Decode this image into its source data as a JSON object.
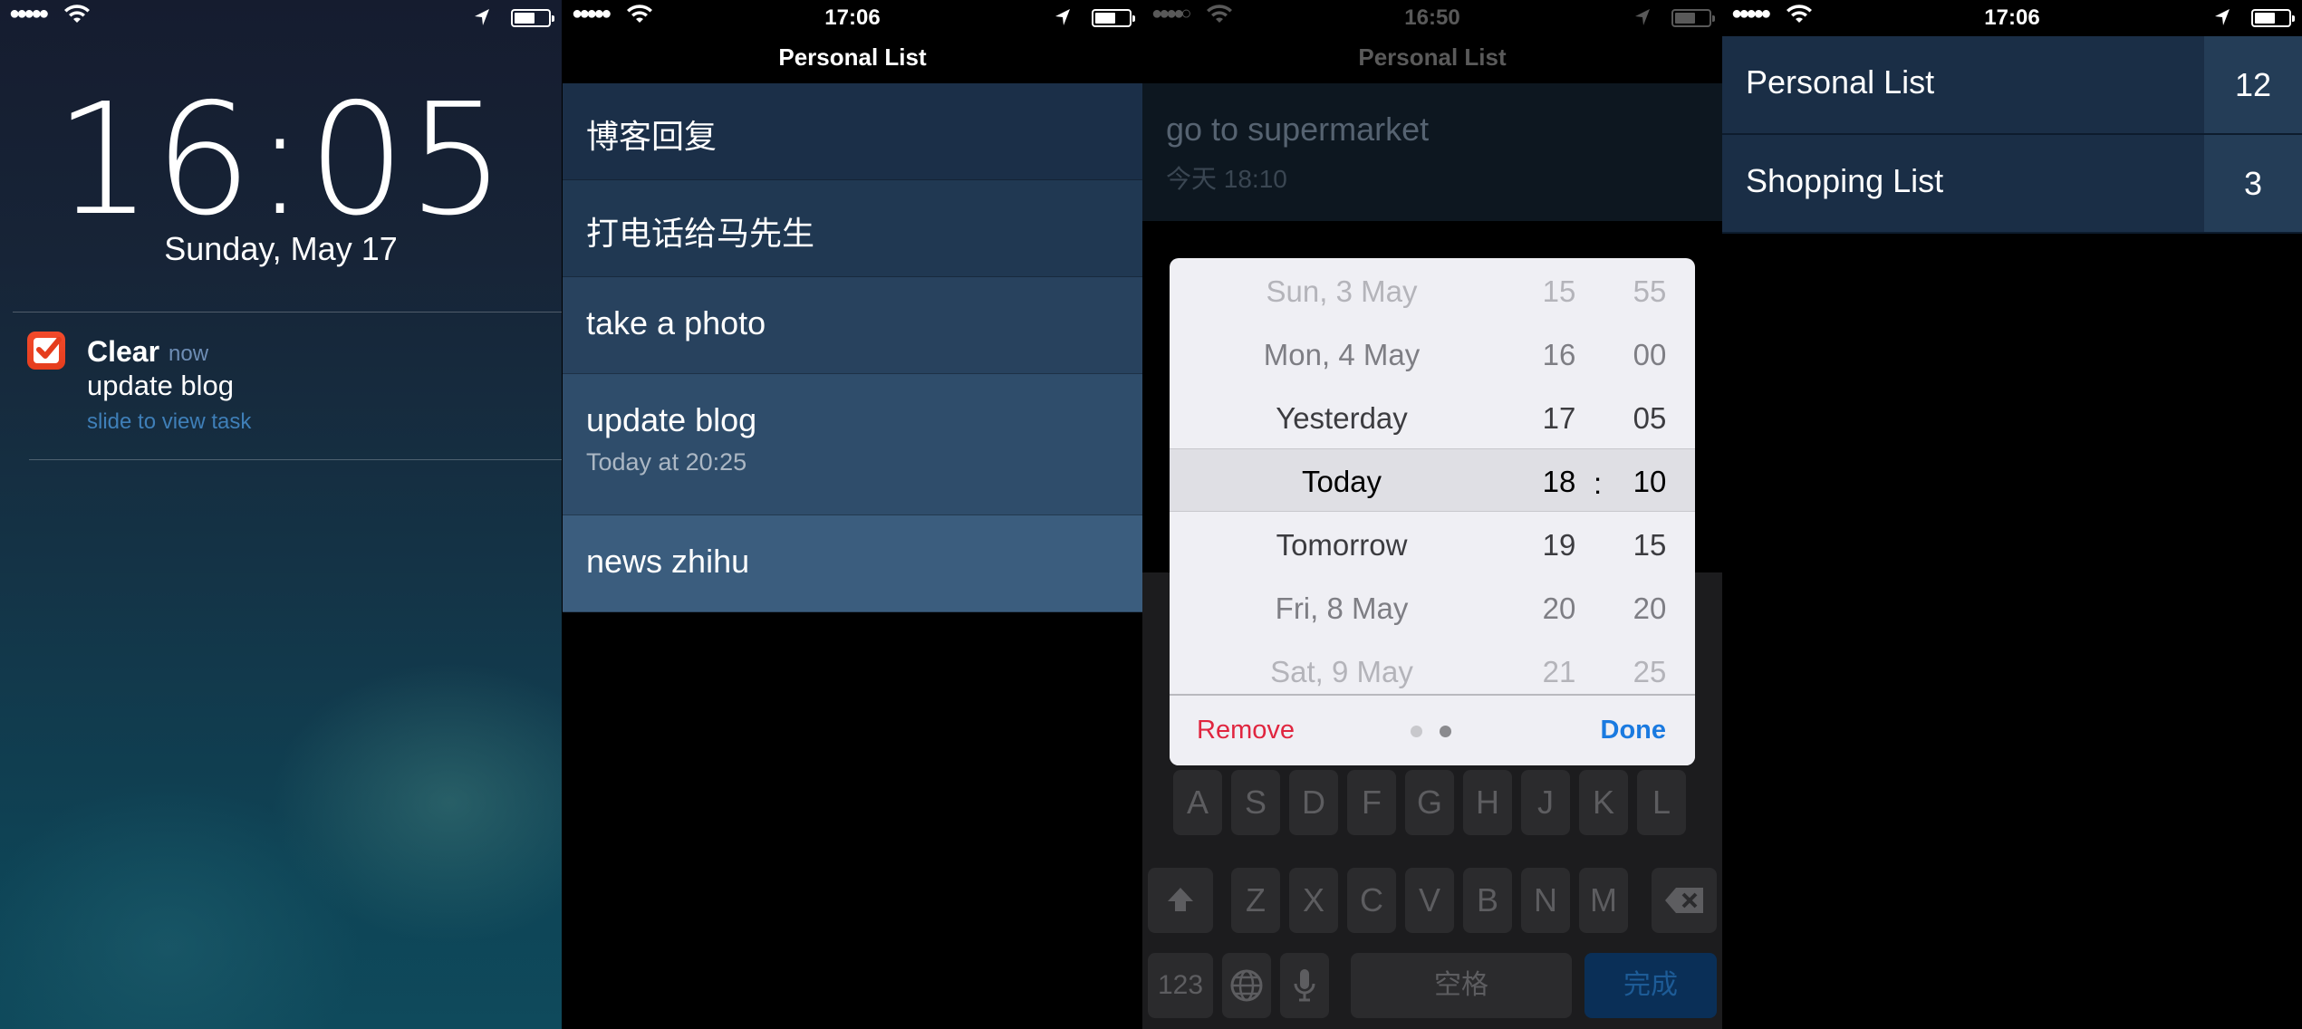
{
  "lock_screen": {
    "status": {
      "signal": "●●●●●"
    },
    "time": "16:05",
    "date": "Sunday, May 17",
    "notification": {
      "app": "Clear",
      "when": "now",
      "message": "update blog",
      "hint": "slide to view task"
    }
  },
  "personal_list": {
    "status": {
      "signal": "●●●●●",
      "time": "17:06"
    },
    "title": "Personal List",
    "tasks": [
      {
        "title": "博客回复",
        "subtitle": "",
        "color": "#1b2f48"
      },
      {
        "title": "打电话给马先生",
        "subtitle": "",
        "color": "#203852"
      },
      {
        "title": "take a photo",
        "subtitle": "",
        "color": "#28425e"
      },
      {
        "title": "update blog",
        "subtitle": "Today at 20:25",
        "color": "#2f4d6b"
      },
      {
        "title": "news zhihu",
        "subtitle": "",
        "color": "#3b5d7e"
      }
    ]
  },
  "reminder_picker": {
    "status": {
      "signal": "●●●●○",
      "time": "16:50"
    },
    "title": "Personal List",
    "task": {
      "title": "go to supermarket",
      "subtitle": "今天 18:10"
    },
    "picker": {
      "rows": [
        {
          "day": "Sun, 3 May",
          "hour": "15",
          "minute": "55",
          "color": "#b4b4ba"
        },
        {
          "day": "Mon, 4 May",
          "hour": "16",
          "minute": "00",
          "color": "#7e7e84"
        },
        {
          "day": "Yesterday",
          "hour": "17",
          "minute": "05",
          "color": "#3c3c40"
        },
        {
          "day": "Today",
          "hour": "18",
          "minute": "10",
          "color": "#000000"
        },
        {
          "day": "Tomorrow",
          "hour": "19",
          "minute": "15",
          "color": "#3c3c40"
        },
        {
          "day": "Fri, 8 May",
          "hour": "20",
          "minute": "20",
          "color": "#7e7e84"
        },
        {
          "day": "Sat, 9 May",
          "hour": "21",
          "minute": "25",
          "color": "#b4b4ba"
        }
      ],
      "separator": ":",
      "remove_label": "Remove",
      "done_label": "Done"
    },
    "keyboard": {
      "row_asdf": [
        "A",
        "S",
        "D",
        "F",
        "G",
        "H",
        "J",
        "K",
        "L"
      ],
      "row_zxcv": [
        "Z",
        "X",
        "C",
        "V",
        "B",
        "N",
        "M"
      ],
      "numbers_key": "123",
      "space_key": "空格",
      "done_key": "完成"
    }
  },
  "lists_overview": {
    "status": {
      "signal": "●●●●●",
      "time": "17:06"
    },
    "lists": [
      {
        "name": "Personal List",
        "count": "12"
      },
      {
        "name": "Shopping List",
        "count": "3"
      }
    ]
  }
}
